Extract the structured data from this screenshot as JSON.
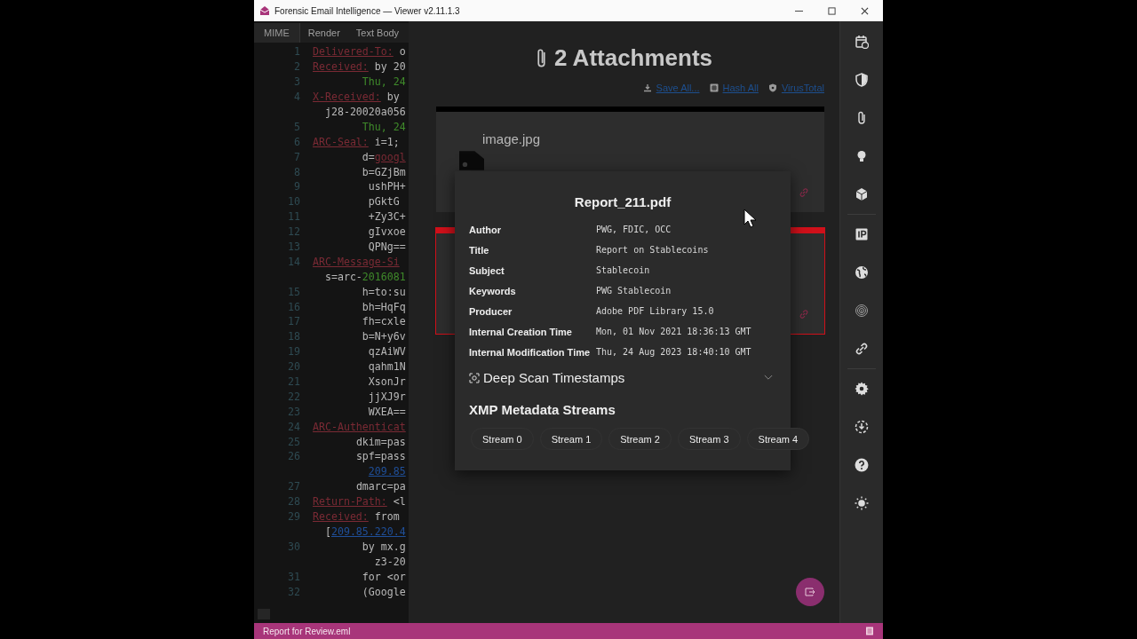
{
  "window": {
    "title": "Forensic Email Intelligence — Viewer v2.11.1.3"
  },
  "code_panel": {
    "tabs": [
      {
        "label": "MIME",
        "selected": true
      },
      {
        "label": "Render",
        "selected": false
      },
      {
        "label": "Text Body",
        "selected": false
      }
    ],
    "lines": [
      {
        "number": "1",
        "parts": [
          {
            "kind": "header",
            "text": "Delivered-To:"
          },
          {
            "kind": "plain",
            "text": " o"
          }
        ]
      },
      {
        "number": "2",
        "parts": [
          {
            "kind": "header",
            "text": "Received:"
          },
          {
            "kind": "plain",
            "text": " by 20"
          }
        ]
      },
      {
        "number": "3",
        "parts": [
          {
            "kind": "date",
            "text": "        Thu, 24"
          }
        ]
      },
      {
        "number": "4",
        "parts": [
          {
            "kind": "header",
            "text": "X-Received:"
          },
          {
            "kind": "plain",
            "text": " by"
          }
        ]
      },
      {
        "parts": [
          {
            "kind": "plain",
            "text": "  j28-20020a056"
          }
        ]
      },
      {
        "number": "5",
        "parts": [
          {
            "kind": "date",
            "text": "        Thu, 24"
          }
        ]
      },
      {
        "number": "6",
        "parts": [
          {
            "kind": "header",
            "text": "ARC-Seal:"
          },
          {
            "kind": "plain",
            "text": " i=1;"
          }
        ]
      },
      {
        "number": "7",
        "parts": [
          {
            "kind": "plain",
            "text": "        d="
          },
          {
            "kind": "domain",
            "text": "googl"
          }
        ]
      },
      {
        "number": "8",
        "parts": [
          {
            "kind": "plain",
            "text": "        b=GZjBm"
          }
        ]
      },
      {
        "number": "9",
        "parts": [
          {
            "kind": "plain",
            "text": "         ushPH+"
          }
        ]
      },
      {
        "number": "10",
        "parts": [
          {
            "kind": "plain",
            "text": "         pGktG"
          }
        ]
      },
      {
        "number": "11",
        "parts": [
          {
            "kind": "plain",
            "text": "         +Zy3C+"
          }
        ]
      },
      {
        "number": "12",
        "parts": [
          {
            "kind": "plain",
            "text": "         gIvxoe"
          }
        ]
      },
      {
        "number": "13",
        "parts": [
          {
            "kind": "plain",
            "text": "         QPNg=="
          }
        ]
      },
      {
        "number": "14",
        "parts": [
          {
            "kind": "header",
            "text": "ARC-Message-Si"
          }
        ]
      },
      {
        "parts": [
          {
            "kind": "plain",
            "text": "  s=arc-"
          },
          {
            "kind": "date",
            "text": "2016081"
          }
        ]
      },
      {
        "number": "15",
        "parts": [
          {
            "kind": "plain",
            "text": "        h=to:su"
          }
        ]
      },
      {
        "number": "16",
        "parts": [
          {
            "kind": "plain",
            "text": "        bh=HqFq"
          }
        ]
      },
      {
        "number": "17",
        "parts": [
          {
            "kind": "plain",
            "text": "        fh=cxle"
          }
        ]
      },
      {
        "number": "18",
        "parts": [
          {
            "kind": "plain",
            "text": "        b=N+y6v"
          }
        ]
      },
      {
        "number": "19",
        "parts": [
          {
            "kind": "plain",
            "text": "         qzAiWV"
          }
        ]
      },
      {
        "number": "20",
        "parts": [
          {
            "kind": "plain",
            "text": "         qahm1N"
          }
        ]
      },
      {
        "number": "21",
        "parts": [
          {
            "kind": "plain",
            "text": "         XsonJr"
          }
        ]
      },
      {
        "number": "22",
        "parts": [
          {
            "kind": "plain",
            "text": "         jjXJ9r"
          }
        ]
      },
      {
        "number": "23",
        "parts": [
          {
            "kind": "plain",
            "text": "         WXEA=="
          }
        ]
      },
      {
        "number": "24",
        "parts": [
          {
            "kind": "header",
            "text": "ARC-Authenticat"
          }
        ]
      },
      {
        "number": "25",
        "parts": [
          {
            "kind": "plain",
            "text": "       dkim=pas"
          }
        ]
      },
      {
        "number": "26",
        "parts": [
          {
            "kind": "plain",
            "text": "       spf=pass"
          }
        ]
      },
      {
        "parts": [
          {
            "kind": "ip",
            "text": "         209.85"
          }
        ]
      },
      {
        "number": "27",
        "parts": [
          {
            "kind": "plain",
            "text": "       dmarc=pa"
          }
        ]
      },
      {
        "number": "28",
        "parts": [
          {
            "kind": "header",
            "text": "Return-Path:"
          },
          {
            "kind": "plain",
            "text": " <l"
          }
        ]
      },
      {
        "number": "29",
        "parts": [
          {
            "kind": "header",
            "text": "Received:"
          },
          {
            "kind": "plain",
            "text": " from"
          }
        ]
      },
      {
        "parts": [
          {
            "kind": "plain",
            "text": "  ["
          },
          {
            "kind": "ip",
            "text": "209.85.220.4"
          }
        ]
      },
      {
        "number": "30",
        "parts": [
          {
            "kind": "plain",
            "text": "        by mx.g"
          }
        ]
      },
      {
        "parts": [
          {
            "kind": "plain",
            "text": "          z3-20"
          }
        ]
      },
      {
        "number": "31",
        "parts": [
          {
            "kind": "plain",
            "text": "        for <or"
          }
        ]
      },
      {
        "number": "32",
        "parts": [
          {
            "kind": "plain",
            "text": "        (Google"
          }
        ]
      }
    ]
  },
  "attachments": {
    "heading": "2 Attachments",
    "actions": [
      {
        "label": "Save All..."
      },
      {
        "label": "Hash All"
      },
      {
        "label": "VirusTotal"
      }
    ],
    "cards": [
      {
        "name": "image.jpg",
        "color": "#000000"
      },
      {
        "color": "#d0101a"
      }
    ]
  },
  "popup": {
    "title": "Report_211.pdf",
    "fields": [
      {
        "label": "Author",
        "value": "PWG, FDIC, OCC"
      },
      {
        "label": "Title",
        "value": "Report on Stablecoins"
      },
      {
        "label": "Subject",
        "value": "Stablecoin"
      },
      {
        "label": "Keywords",
        "value": "PWG Stablecoin"
      },
      {
        "label": "Producer",
        "value": "Adobe PDF Library 15.0"
      },
      {
        "label": "Internal Creation Time",
        "value": "Mon, 01 Nov 2021 18:36:13 GMT"
      },
      {
        "label": "Internal Modification Time",
        "value": "Thu, 24 Aug 2023 18:40:10 GMT"
      }
    ],
    "deep_scan": {
      "label": "Deep Scan Timestamps",
      "expanded": false
    },
    "xmp": {
      "heading": "XMP Metadata Streams",
      "streams": [
        "Stream 0",
        "Stream 1",
        "Stream 2",
        "Stream 3",
        "Stream 4"
      ]
    }
  },
  "status_bar": {
    "file": "Report for Review.eml"
  }
}
